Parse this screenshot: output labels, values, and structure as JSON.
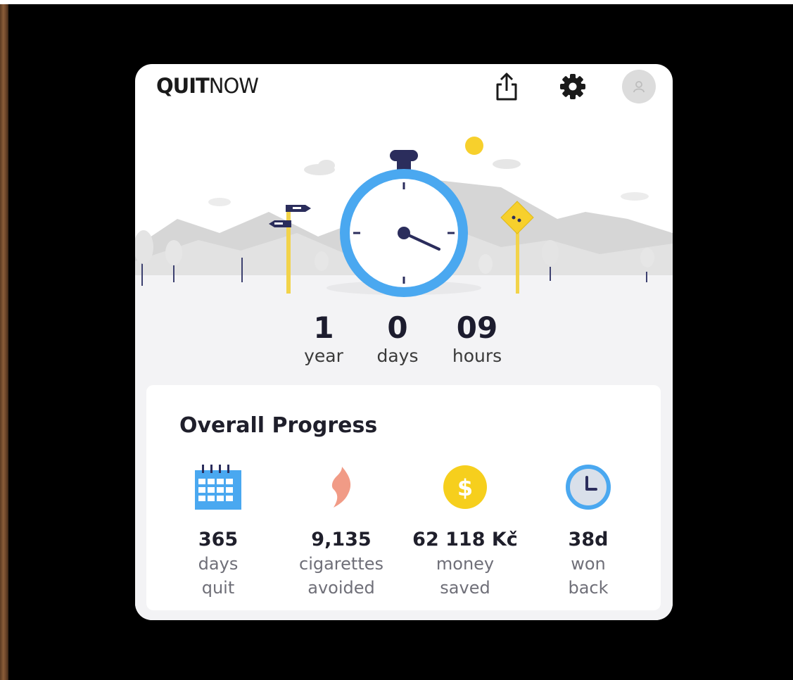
{
  "app": {
    "logo_bold": "QUIT",
    "logo_light": "NOW"
  },
  "header_icons": [
    "share-icon",
    "gear-icon",
    "avatar"
  ],
  "timer": {
    "years": "1",
    "years_label": "year",
    "days": "0",
    "days_label": "days",
    "hours": "09",
    "hours_label": "hours"
  },
  "progress": {
    "title": "Overall Progress",
    "stats": [
      {
        "icon": "calendar-icon",
        "value": "365",
        "line1": "days",
        "line2": "quit"
      },
      {
        "icon": "flame-icon",
        "value": "9,135",
        "line1": "cigarettes",
        "line2": "avoided"
      },
      {
        "icon": "dollar-coin-icon",
        "value": "62 118 Kč",
        "line1": "money",
        "line2": "saved"
      },
      {
        "icon": "clock-icon",
        "value": "38d",
        "line1": "won",
        "line2": "back"
      }
    ]
  },
  "colors": {
    "accent_blue": "#4aa8f0",
    "sun_yellow": "#f7d02c",
    "flame": "#f19b86",
    "coin": "#f6cf1d",
    "navy": "#2b2d5c"
  }
}
